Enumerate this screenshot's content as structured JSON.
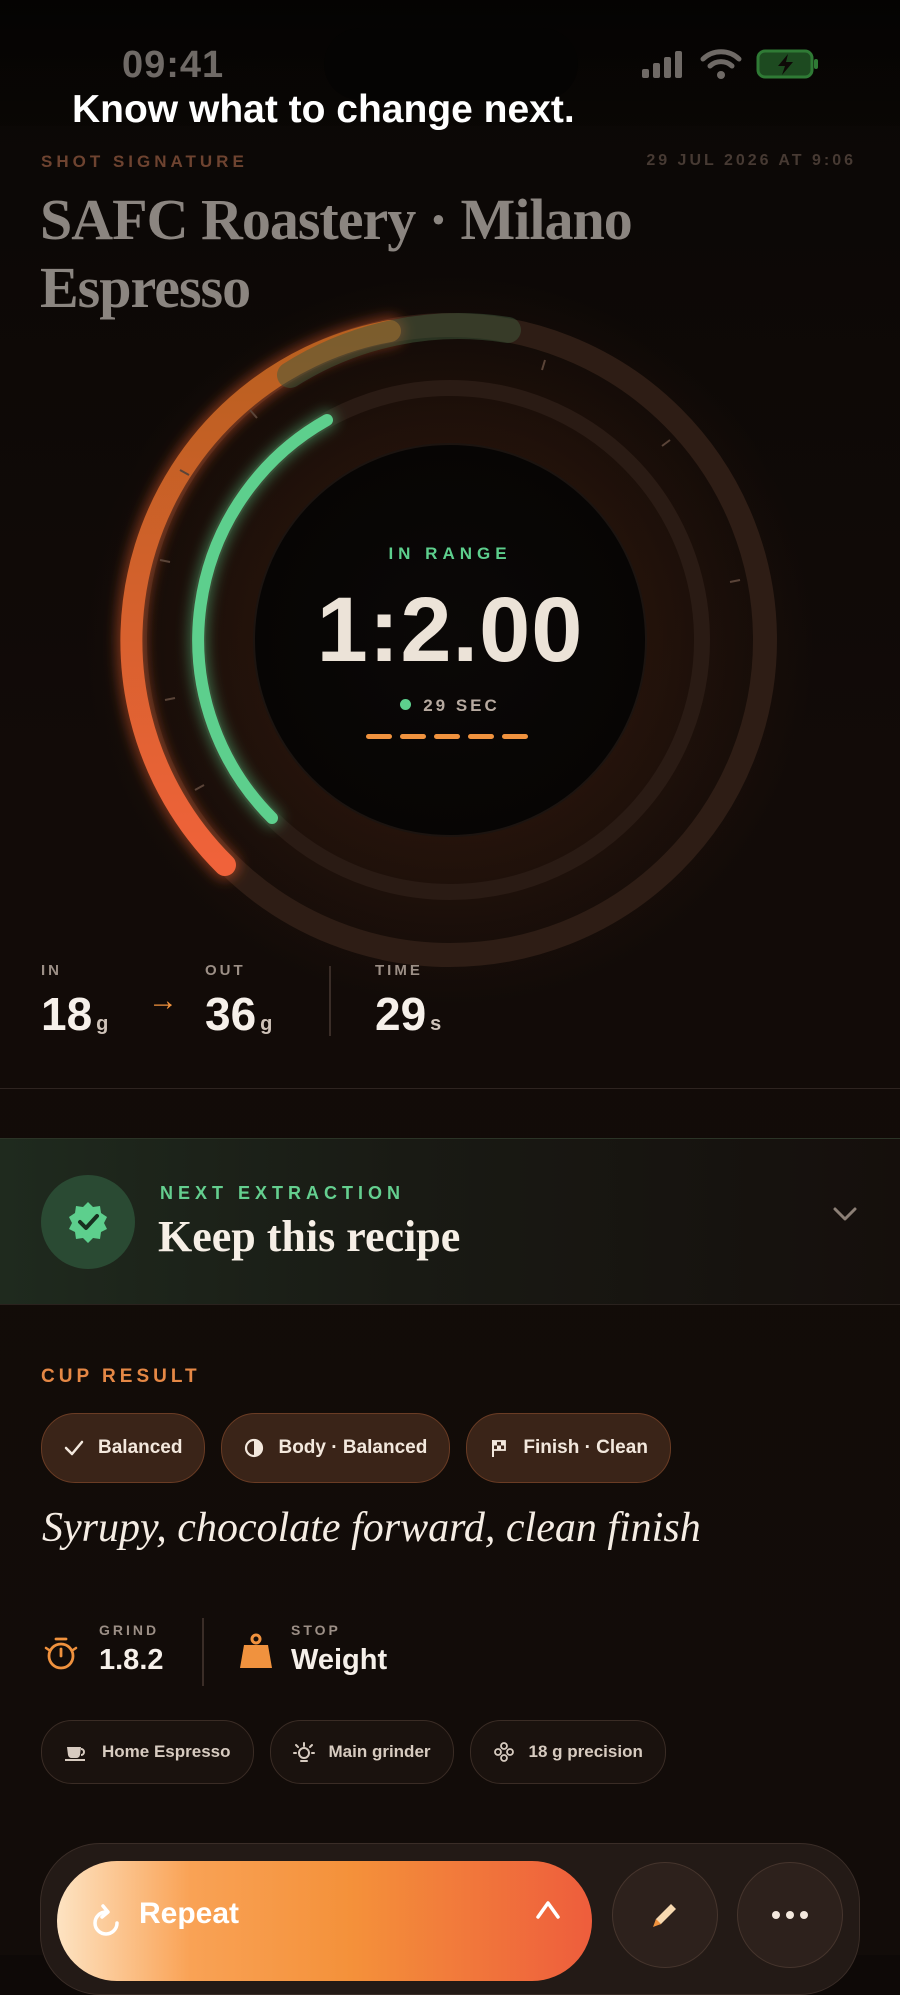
{
  "status_bar": {
    "time": "09:41"
  },
  "overlay_heading": "Know what to change next.",
  "shot": {
    "eyebrow": "SHOT SIGNATURE",
    "datestamp": "29 JUL 2026 AT 9:06",
    "title": "SAFC Roastery · Milano Espresso"
  },
  "dial": {
    "status": "IN RANGE",
    "ratio": "1:2.00",
    "seconds": "29 SEC",
    "dash_count": 5,
    "colors": {
      "accent": "#f0923e",
      "in_range": "#5dcf8d",
      "outer_arc": "#e8602e"
    }
  },
  "stats": {
    "in": {
      "label": "IN",
      "value": "18",
      "unit": "g"
    },
    "out": {
      "label": "OUT",
      "value": "36",
      "unit": "g"
    },
    "time": {
      "label": "TIME",
      "value": "29",
      "unit": "s"
    }
  },
  "next_extraction": {
    "label": "NEXT EXTRACTION",
    "title": "Keep this recipe",
    "icon": "verified-badge-icon"
  },
  "cup_result": {
    "heading": "CUP RESULT",
    "chips": [
      {
        "label": "Balanced",
        "icon": "check-icon"
      },
      {
        "label": "Body · Balanced",
        "icon": "half-circle-icon"
      },
      {
        "label": "Finish · Clean",
        "icon": "flag-icon"
      }
    ],
    "tasting_note": "Syrupy, chocolate forward, clean finish"
  },
  "grind": {
    "label": "GRIND",
    "value": "1.8.2"
  },
  "stop": {
    "label": "STOP",
    "value": "Weight"
  },
  "equipment": [
    {
      "label": "Home Espresso",
      "icon": "cup-icon"
    },
    {
      "label": "Main grinder",
      "icon": "grinder-icon"
    },
    {
      "label": "18 g precision",
      "icon": "scale-icon"
    }
  ],
  "actions": {
    "repeat_label": "Repeat"
  }
}
